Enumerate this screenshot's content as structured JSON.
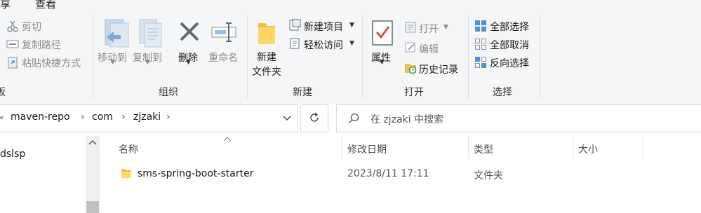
{
  "ribbon": {
    "tabs": [
      "享",
      "查看"
    ],
    "clipboard": {
      "cut": "剪切",
      "copy_path": "复制路径",
      "paste_shortcut": "粘贴快捷方式",
      "group_label_fragment": "板"
    },
    "organize": {
      "move_to": "移动到",
      "copy_to": "复制到",
      "delete": "删除",
      "rename": "重命名",
      "group_label": "组织"
    },
    "new": {
      "new_folder_line1": "新建",
      "new_folder_line2": "文件夹",
      "new_item": "新建项目",
      "easy_access": "轻松访问",
      "group_label": "新建"
    },
    "open": {
      "properties": "属性",
      "open": "打开",
      "edit": "编辑",
      "history": "历史记录",
      "group_label": "打开"
    },
    "select": {
      "select_all": "全部选择",
      "select_none": "全部取消",
      "invert": "反向选择",
      "group_label": "选择"
    }
  },
  "address": {
    "crumbs": [
      "maven-repo",
      "com",
      "zjzaki"
    ],
    "search_placeholder": "在 zjzaki 中搜索"
  },
  "nav": {
    "item": "dslsp"
  },
  "columns": {
    "name": "名称",
    "date": "修改日期",
    "type": "类型",
    "size": "大小"
  },
  "files": [
    {
      "name": "sms-spring-boot-starter",
      "date": "2023/8/11 17:11",
      "type": "文件夹",
      "size": ""
    }
  ]
}
